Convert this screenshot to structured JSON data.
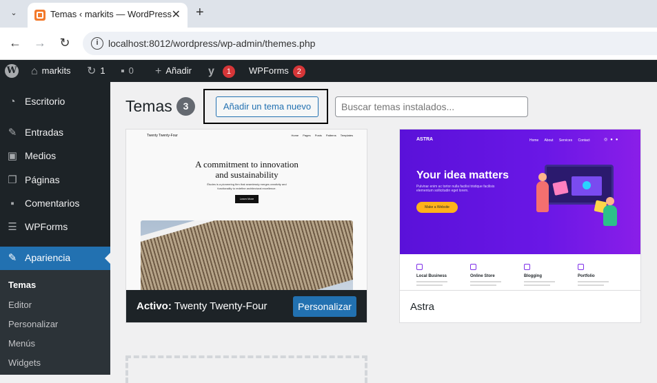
{
  "browser": {
    "tab_title": "Temas ‹ markits — WordPress",
    "new_tab_symbol": "+",
    "close_symbol": "✕",
    "url": "localhost:8012/wordpress/wp-admin/themes.php"
  },
  "adminbar": {
    "site_name": "markits",
    "updates_count": "1",
    "comments_count": "0",
    "new_label": "Añadir",
    "yoast_count": "1",
    "wpforms_label": "WPForms",
    "wpforms_count": "2"
  },
  "sidebar": {
    "items": [
      {
        "label": "Escritorio",
        "icon": "dashboard-icon"
      },
      {
        "label": "Entradas",
        "icon": "pin-icon"
      },
      {
        "label": "Medios",
        "icon": "media-icon"
      },
      {
        "label": "Páginas",
        "icon": "pages-icon"
      },
      {
        "label": "Comentarios",
        "icon": "comments-icon"
      },
      {
        "label": "WPForms",
        "icon": "forms-icon"
      },
      {
        "label": "Apariencia",
        "icon": "brush-icon"
      }
    ],
    "submenu": [
      "Temas",
      "Editor",
      "Personalizar",
      "Menús",
      "Widgets"
    ]
  },
  "main": {
    "title": "Temas",
    "count": "3",
    "add_button": "Añadir un tema nuevo",
    "search_placeholder": "Buscar temas instalados..."
  },
  "themes": [
    {
      "name": "Twenty Twenty-Four",
      "active_prefix": "Activo:",
      "customize_label": "Personalizar",
      "preview": {
        "brand": "Twenty Twenty-Four",
        "nav": "Home Pages Posts Patterns Templates",
        "headline_1": "A commitment to innovation",
        "headline_2": "and sustainability",
        "body": "Études is a pioneering firm that seamlessly merges creativity and functionality to redefine architectural excellence.",
        "button": "Learn More"
      }
    },
    {
      "name": "Astra",
      "preview": {
        "logo": "ASTRA",
        "nav": "Home About Services Contact",
        "headline": "Your idea matters",
        "body": "Pulvinar enim ac tortor nulla facilisi tristique facilisis elementum sollicitudin eget lorem.",
        "button": "Make a Website",
        "services": [
          "Local Business",
          "Online Store",
          "Blogging",
          "Portfolio"
        ]
      }
    }
  ],
  "colors": {
    "admin_dark": "#1d2327",
    "accent_blue": "#2271b1",
    "badge_red": "#d63638",
    "astra_purple": "#5a11d9"
  }
}
